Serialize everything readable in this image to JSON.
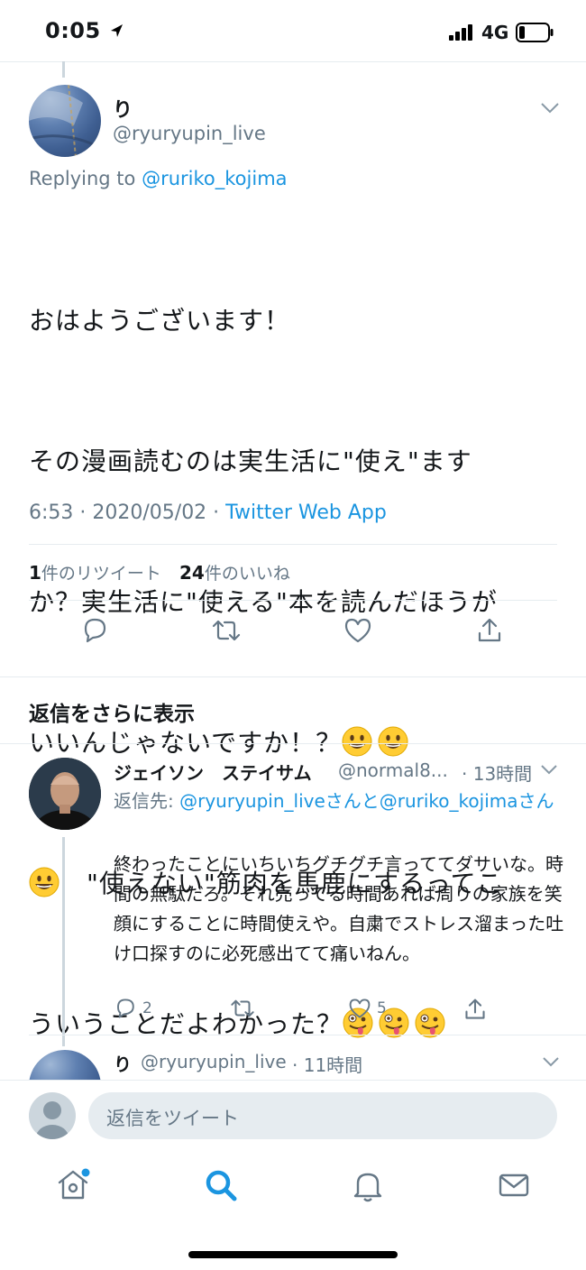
{
  "status_bar": {
    "time": "0:05",
    "network": "4G"
  },
  "main_tweet": {
    "display_name": "り",
    "handle": "@ryuryupin_live",
    "replying_prefix": "Replying to",
    "replying_to": "@ruriko_kojima",
    "line1": "おはようございます！",
    "line2": "その漫画読むのは実生活に\"使え\"ます",
    "line3": "か？実生活に\"使える\"本を読んだほうが",
    "line4": "いいんじゃないですか！？",
    "line5": "\"使えない\"筋肉を馬鹿にするってこ",
    "line6": "ういうことだよわかった？",
    "time": "6:53 · 2020/05/02 · ",
    "source": "Twitter Web App",
    "retweets_count": "1",
    "retweets_label": "件のリツイート",
    "likes_count": "24",
    "likes_label": "件のいいね"
  },
  "more_replies_label": "返信をさらに表示",
  "reply_tweet": {
    "display_name": "ジェイソン　ステイサム",
    "handle": "@normal8...",
    "time": "· 13時間",
    "reply_to_prefix": "返信先: ",
    "reply_to_users": "@ryuryupin_liveさんと@ruriko_kojimaさん",
    "text": "終わったことにいちいちグチグチ言っててダサいな。時間の無駄だろ。それ売ってる時間あれば周りの家族を笑顔にすることに時間使えや。自粛でストレス溜まった吐け口探すのに必死感出てて痛いねん。",
    "reply_count": "2",
    "like_count": "5"
  },
  "third_tweet": {
    "display_name": "り",
    "handle": "@ryuryupin_live",
    "time": "· 11時間"
  },
  "composer": {
    "placeholder": "返信をツイート"
  },
  "icons": {
    "reply": "reply-icon",
    "retweet": "retweet-icon",
    "like": "heart-icon",
    "share": "share-icon",
    "home": "home-icon",
    "search": "search-icon",
    "notifications": "bell-icon",
    "messages": "mail-icon",
    "emoji_smile": "grinning-face-emoji",
    "emoji_zany": "zany-face-emoji"
  },
  "colors": {
    "accent": "#1b95e0",
    "secondary_text": "#657786",
    "divider": "#e6ecf0"
  }
}
